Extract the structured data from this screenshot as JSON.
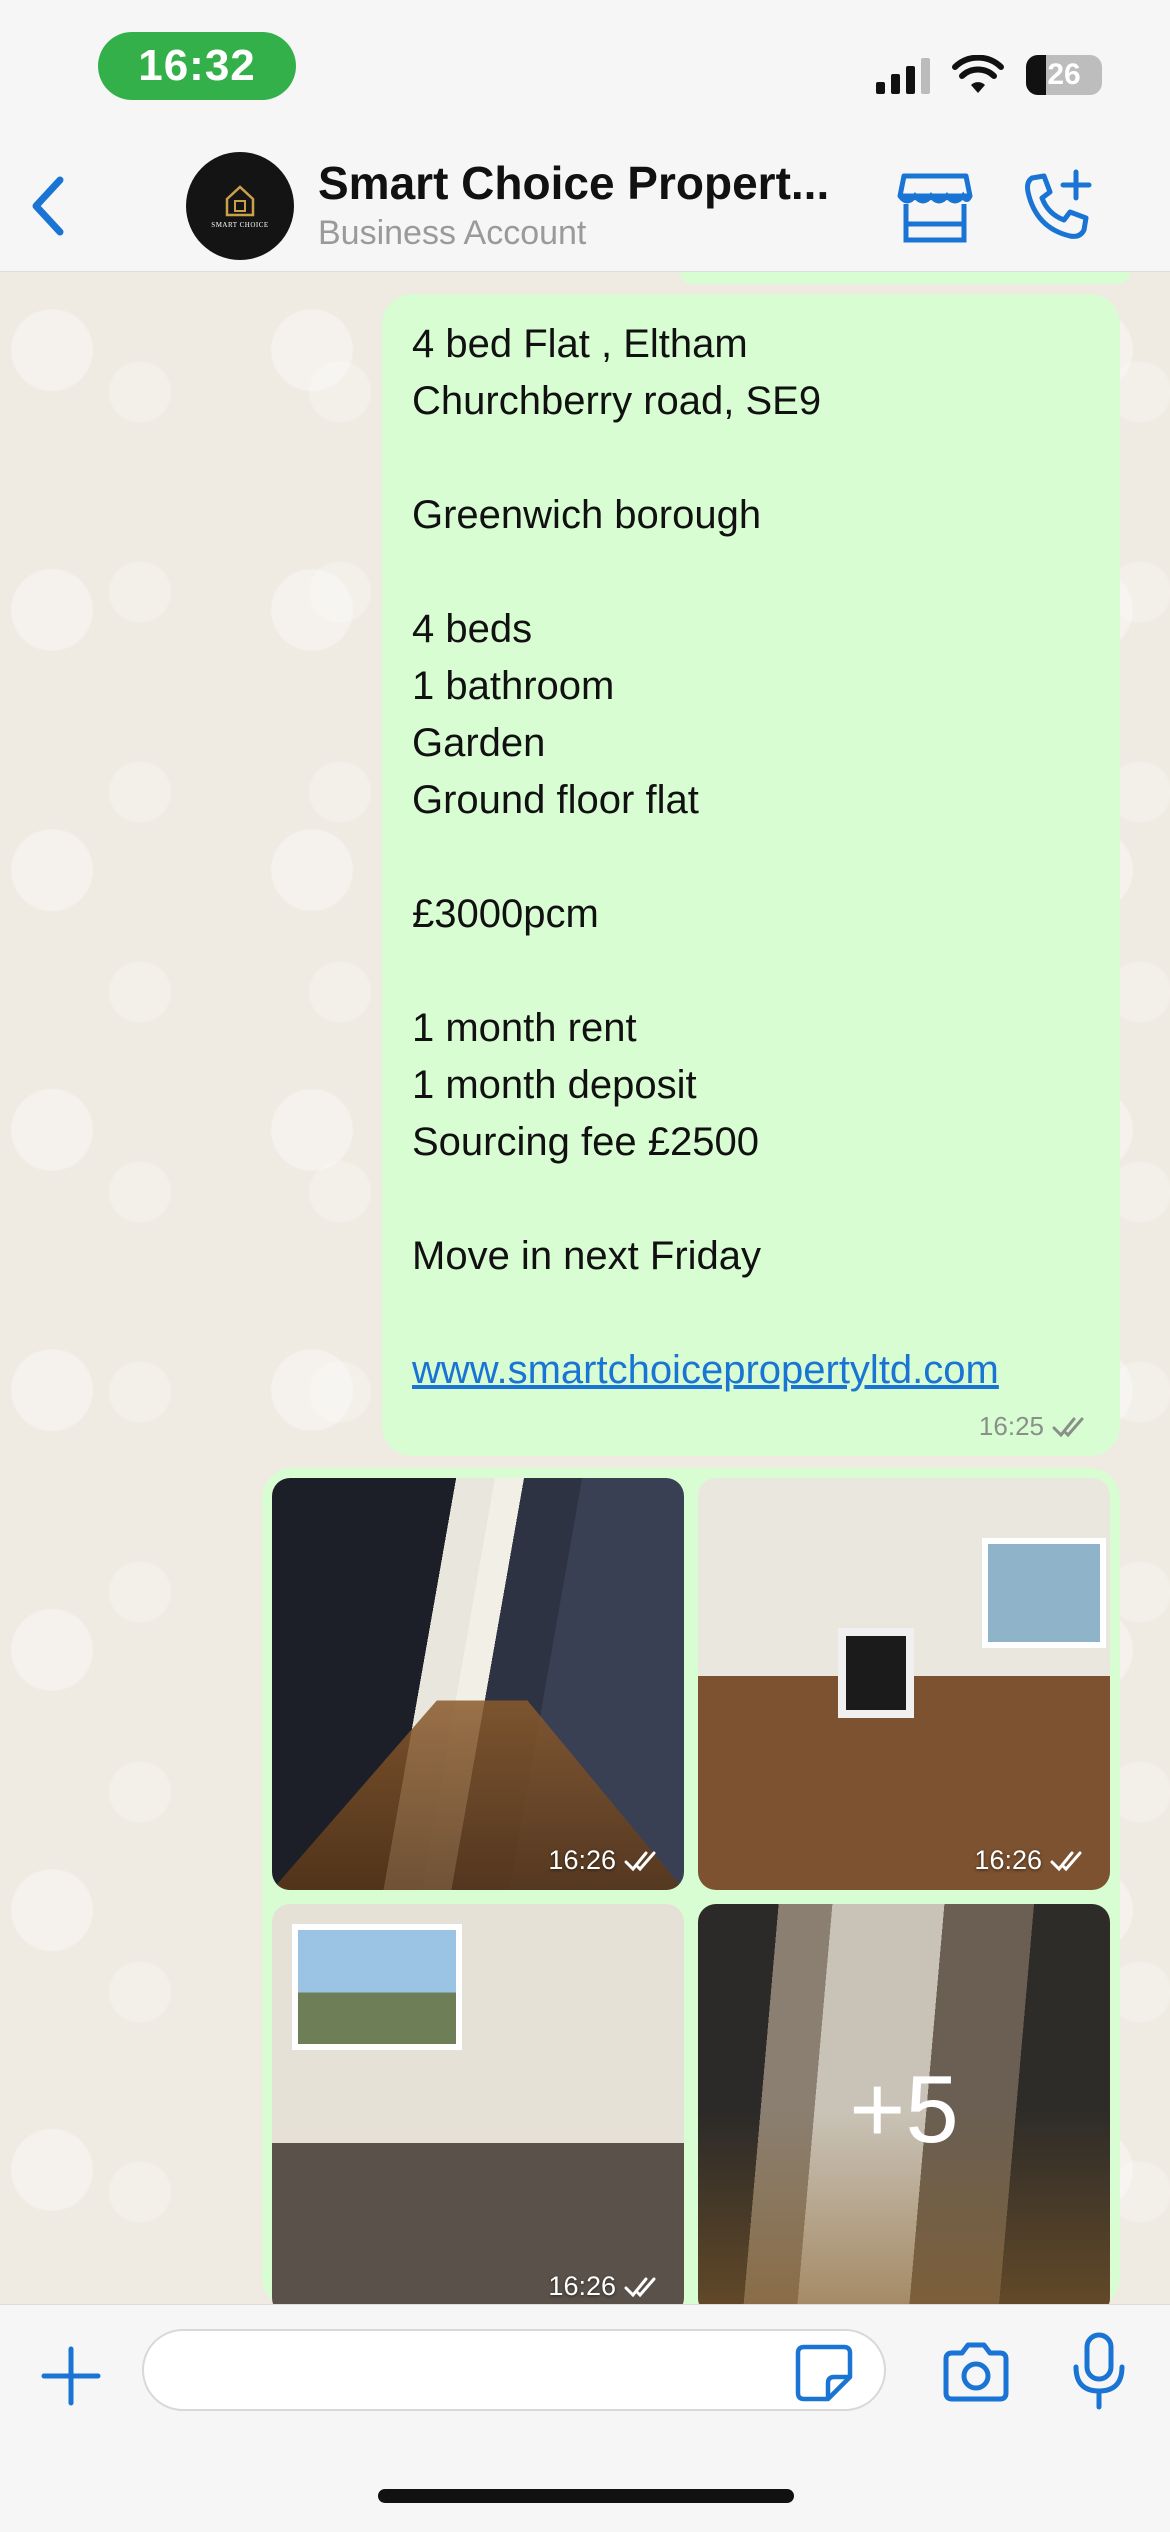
{
  "status_bar": {
    "time": "16:32",
    "battery": "26"
  },
  "header": {
    "contact_name": "Smart Choice Propert...",
    "contact_subtitle": "Business Account",
    "avatar_brand": "SMART CHOICE"
  },
  "message": {
    "lines": [
      "4 bed Flat , Eltham",
      "Churchberry road, SE9",
      "",
      "Greenwich borough",
      "",
      "4 beds",
      "1 bathroom",
      "Garden",
      "Ground floor flat",
      "",
      "£3000pcm",
      "",
      "1 month rent",
      "1 month deposit",
      "Sourcing fee £2500",
      "",
      "Move in next Friday",
      ""
    ],
    "link": "www.smartchoicepropertyltd.com",
    "time": "16:25"
  },
  "album": {
    "photos": [
      {
        "time": "16:26"
      },
      {
        "time": "16:26"
      },
      {
        "time": "16:26"
      }
    ],
    "more_count": "+5"
  },
  "input": {
    "placeholder": "",
    "value": ""
  },
  "colors": {
    "accent": "#1a74d4",
    "outgoing_bubble": "#d9fdd3",
    "time_pill": "#34b04a",
    "chat_background": "#efeae2"
  },
  "icons": [
    "back-chevron-icon",
    "storefront-icon",
    "call-add-icon",
    "plus-icon",
    "sticker-icon",
    "camera-icon",
    "microphone-icon",
    "double-check-icon"
  ]
}
